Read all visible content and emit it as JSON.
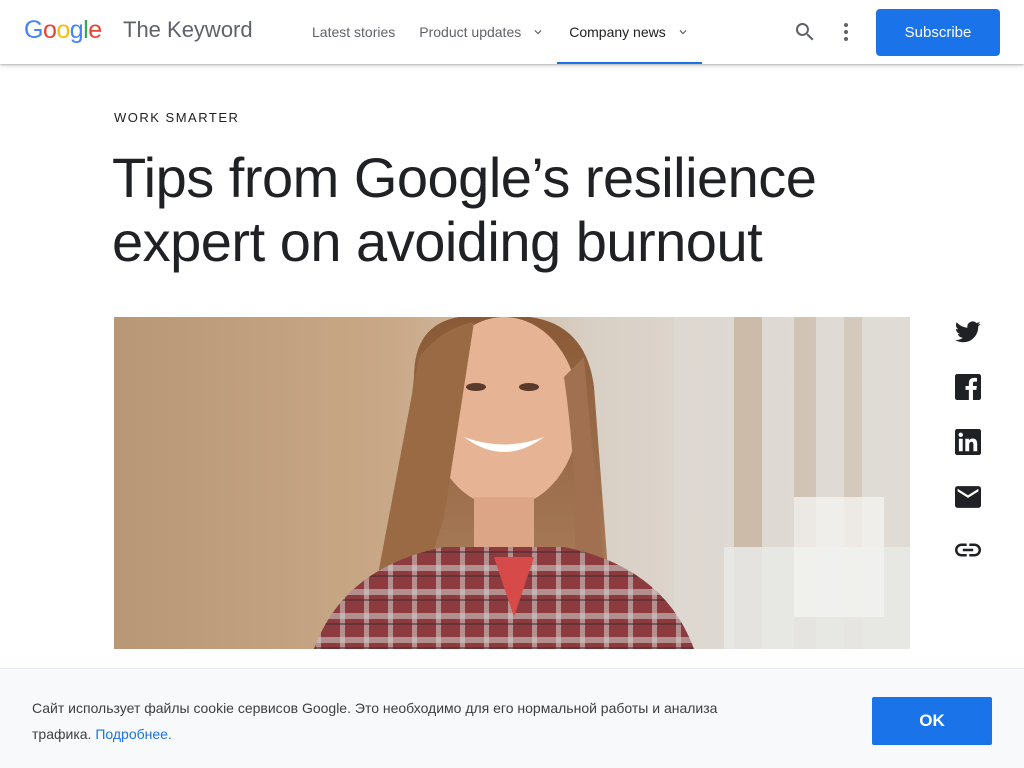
{
  "header": {
    "logo_letters": [
      {
        "char": "G",
        "color": "#4285F4"
      },
      {
        "char": "o",
        "color": "#EA4335"
      },
      {
        "char": "o",
        "color": "#FBBC05"
      },
      {
        "char": "g",
        "color": "#4285F4"
      },
      {
        "char": "l",
        "color": "#34A853"
      },
      {
        "char": "e",
        "color": "#EA4335"
      }
    ],
    "site_title": "The Keyword",
    "nav": [
      {
        "label": "Latest stories",
        "has_dropdown": false,
        "active": false
      },
      {
        "label": "Product updates",
        "has_dropdown": true,
        "active": false
      },
      {
        "label": "Company news",
        "has_dropdown": true,
        "active": true
      }
    ],
    "search_icon": "search-icon",
    "more_icon": "more-vert-icon",
    "subscribe_label": "Subscribe"
  },
  "article": {
    "eyebrow": "WORK SMARTER",
    "title": "Tips from Google’s resilience expert on avoiding burnout"
  },
  "share_icons": [
    "twitter-icon",
    "facebook-icon",
    "linkedin-icon",
    "email-icon",
    "link-icon"
  ],
  "cookie_banner": {
    "text": "Сайт использует файлы cookie сервисов Google. Это необходимо для его нормальной работы и анализа трафика. ",
    "link_label": "Подробнее.",
    "ok_label": "OK"
  },
  "colors": {
    "accent": "#1a73e8",
    "text": "#202124",
    "muted": "#5f6368"
  }
}
